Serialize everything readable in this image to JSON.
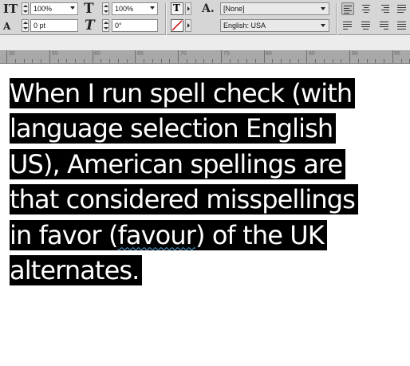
{
  "toolbar": {
    "font_size_glyph": "IT",
    "horizontal_scale_value": "100%",
    "vertical_scale_value": "100%",
    "baseline_shift_value": "0 pt",
    "skew_value": "0°",
    "character_style_value": "[None]",
    "language_value": "English: USA",
    "superscript_glyph": "A",
    "horizontal_scale_glyph": "T",
    "skew_glyph": "T",
    "char_style_glyph": "A."
  },
  "ruler": {
    "labels": [
      "50",
      "55",
      "60",
      "65",
      "70",
      "75",
      "80",
      "85",
      "90",
      "95"
    ]
  },
  "document": {
    "lines": [
      "When I run spell check (with",
      "language selection English",
      "US), American spellings are",
      "that considered misspellings"
    ],
    "line5_before": "in favor (",
    "line5_flagged": "favour",
    "line5_after": ") of the UK",
    "line6": "alternates."
  },
  "colors": {
    "selection_highlight": "#000000",
    "selected_text": "#ffffff",
    "spelling_squiggle": "#4aa3d8",
    "toolbar_bg": "#d6d6d6",
    "ruler_bg": "#a8a8a8"
  },
  "icons": [
    "stroke-color-swatch-icon",
    "text-color-swatch-icon",
    "align-left-icon",
    "align-center-icon",
    "align-right-icon",
    "justify-icon"
  ]
}
